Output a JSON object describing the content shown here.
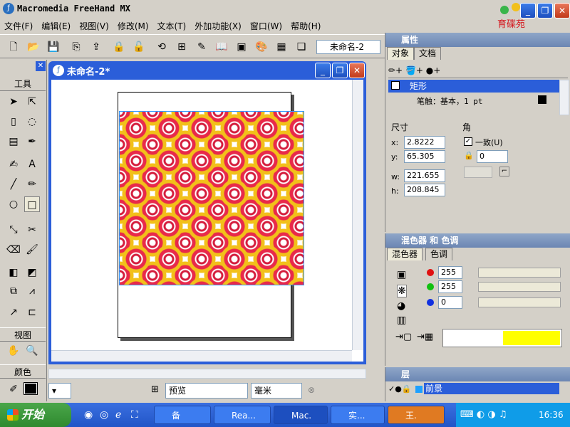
{
  "app": {
    "title": "Macromedia FreeHand MX",
    "logo_text": "育碟苑"
  },
  "window_controls": {
    "minimize": "_",
    "restore": "❐",
    "close": "✕"
  },
  "menu": [
    "文件(F)",
    "编辑(E)",
    "视图(V)",
    "修改(M)",
    "文本(T)",
    "外加功能(X)",
    "窗口(W)",
    "帮助(H)"
  ],
  "toolbar": {
    "doc_dropdown": "未命名-2"
  },
  "tools": {
    "title": "工具",
    "view_title": "视图",
    "color_title": "颜色"
  },
  "document": {
    "title": "未命名-2*",
    "controls": {
      "minimize": "_",
      "restore": "❐",
      "close": "✕"
    }
  },
  "statusbar": {
    "preview_mode": "预览",
    "units": "毫米"
  },
  "properties": {
    "title": "属性",
    "tabs": [
      "对象",
      "文档"
    ],
    "object_name": "矩形",
    "stroke_label": "笔触：基本，1 pt",
    "dimensions_title": "尺寸",
    "x_label": "x:",
    "x_value": "2.8222",
    "y_label": "y:",
    "y_value": "65.305",
    "w_label": "w:",
    "w_value": "221.655",
    "h_label": "h:",
    "h_value": "208.845",
    "corner_title": "角",
    "uniform_label": "一致(U)",
    "corner_value": "0"
  },
  "mixer": {
    "title": "混色器 和 色调",
    "tabs": [
      "混色器",
      "色调"
    ],
    "r_value": "255",
    "g_value": "255",
    "b_value": "0",
    "preview_color": "#ffff00"
  },
  "layers": {
    "title": "层",
    "layer_name": "前景"
  },
  "taskbar": {
    "start": "开始",
    "tasks": [
      "备",
      "Rea...",
      "Mac.",
      "实...",
      "王."
    ],
    "clock": "16:36"
  }
}
